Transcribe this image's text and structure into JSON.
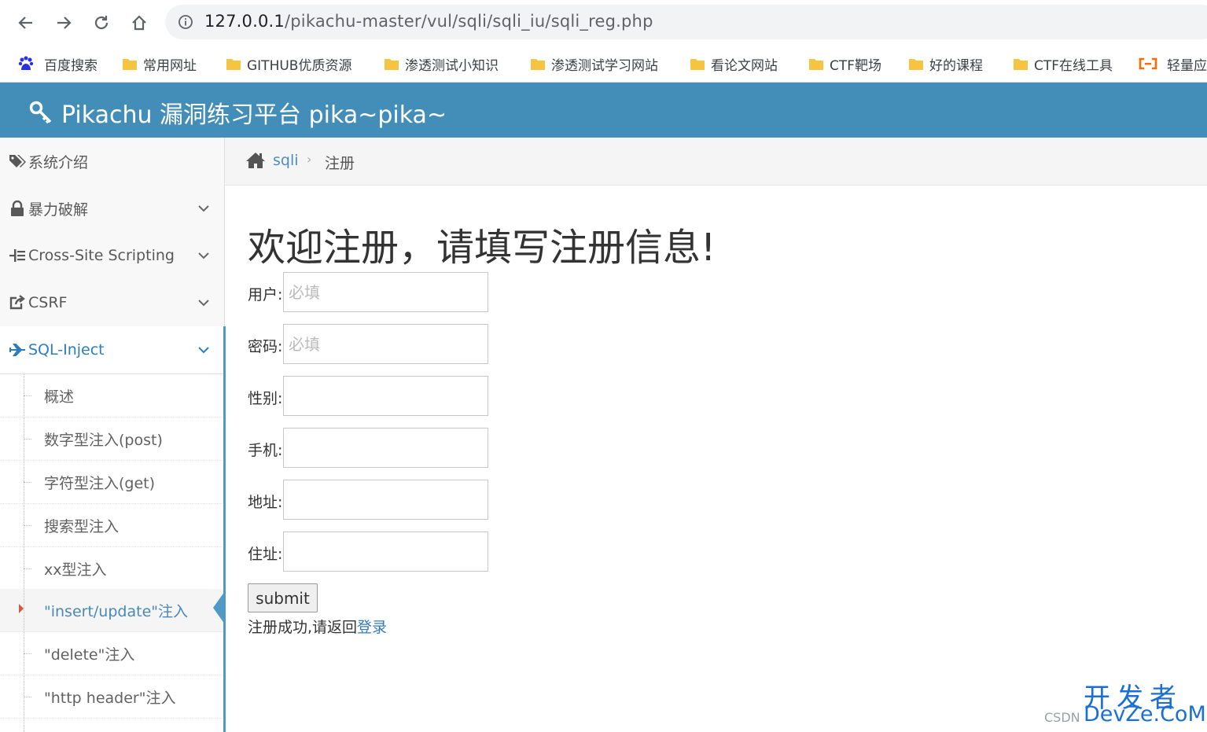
{
  "browser": {
    "url_host": "127.0.0.1",
    "url_path": "/pikachu-master/vul/sqli/sqli_iu/sqli_reg.php",
    "bookmarks": [
      {
        "label": "百度搜索",
        "icon": "baidu-icon"
      },
      {
        "label": "常用网址",
        "icon": "folder-icon"
      },
      {
        "label": "GITHUB优质资源",
        "icon": "folder-icon"
      },
      {
        "label": "渗透测试小知识",
        "icon": "folder-icon"
      },
      {
        "label": "渗透测试学习网站",
        "icon": "folder-icon"
      },
      {
        "label": "看论文网站",
        "icon": "folder-icon"
      },
      {
        "label": "CTF靶场",
        "icon": "folder-icon"
      },
      {
        "label": "好的课程",
        "icon": "folder-icon"
      },
      {
        "label": "CTF在线工具",
        "icon": "folder-icon"
      },
      {
        "label": "轻量应",
        "icon": "aliyun-icon"
      }
    ]
  },
  "header": {
    "title": "Pikachu 漏洞练习平台 pika~pika~",
    "accent": "#438eb9"
  },
  "sidebar": {
    "items": [
      {
        "label": "系统介绍",
        "icon": "tags-icon"
      },
      {
        "label": "暴力破解",
        "icon": "lock-icon"
      },
      {
        "label": "Cross-Site Scripting",
        "icon": "list-icon"
      },
      {
        "label": "CSRF",
        "icon": "share-icon"
      },
      {
        "label": "SQL-Inject",
        "icon": "plane-icon"
      }
    ],
    "sub_items": [
      "概述",
      "数字型注入(post)",
      "字符型注入(get)",
      "搜索型注入",
      "xx型注入",
      "\"insert/update\"注入",
      "\"delete\"注入",
      "\"http header\"注入"
    ]
  },
  "breadcrumb": {
    "section": "sqli",
    "current": "注册"
  },
  "main": {
    "heading": "欢迎注册，请填写注册信息!",
    "fields": [
      {
        "label": "用户:",
        "placeholder": "必填",
        "value": ""
      },
      {
        "label": "密码:",
        "placeholder": "必填",
        "value": ""
      },
      {
        "label": "性别:",
        "placeholder": "",
        "value": ""
      },
      {
        "label": "手机:",
        "placeholder": "",
        "value": ""
      },
      {
        "label": "地址:",
        "placeholder": "",
        "value": ""
      },
      {
        "label": "住址:",
        "placeholder": "",
        "value": ""
      }
    ],
    "submit_label": "submit",
    "message": "注册成功,请返回",
    "login_link": "登录"
  },
  "watermark": {
    "line1": "开发者",
    "line2": "DevZe.CoM",
    "csdn": "CSDN"
  }
}
